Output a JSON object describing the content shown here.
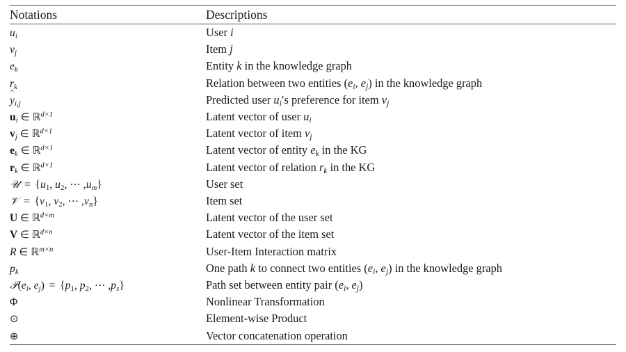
{
  "table": {
    "headers": {
      "notation": "Notations",
      "description": "Descriptions"
    },
    "rows": [
      {
        "notation": "u_i",
        "description": "User i"
      },
      {
        "notation": "v_j",
        "description": "Item j"
      },
      {
        "notation": "e_k",
        "description": "Entity k in the knowledge graph"
      },
      {
        "notation": "r_k",
        "description": "Relation between two entities (e_i, e_j) in the knowledge graph"
      },
      {
        "notation": "ŷ_{i,j}",
        "description": "Predicted user u_i's preference for item v_j"
      },
      {
        "notation": "u_i ∈ ℝ^{d×1}",
        "description": "Latent vector of user u_i"
      },
      {
        "notation": "v_j ∈ ℝ^{d×1}",
        "description": "Latent vector of item v_j"
      },
      {
        "notation": "e_k ∈ ℝ^{d×1}",
        "description": "Latent vector of entity e_k in the KG"
      },
      {
        "notation": "r_k ∈ ℝ^{d×1}",
        "description": "Latent vector of relation r_k in the KG"
      },
      {
        "notation": "𝒰 = {u_1, u_2, ⋯ , u_m}",
        "description": "User set"
      },
      {
        "notation": "𝒱 = {v_1, v_2, ⋯ , v_n}",
        "description": "Item set"
      },
      {
        "notation": "U ∈ ℝ^{d×m}",
        "description": "Latent vector of the user set"
      },
      {
        "notation": "V ∈ ℝ^{d×n}",
        "description": "Latent vector of the item set"
      },
      {
        "notation": "R ∈ ℝ^{m×n}",
        "description": "User-Item Interaction matrix"
      },
      {
        "notation": "p_k",
        "description": "One path k to connect two entities (e_i, e_j) in the knowledge graph"
      },
      {
        "notation": "𝒫(e_i, e_j) = {p_1, p_2, ⋯ , p_s}",
        "description": "Path set between entity pair (e_i, e_j)"
      },
      {
        "notation": "Φ",
        "description": "Nonlinear Transformation"
      },
      {
        "notation": "⊙",
        "description": "Element-wise Product"
      },
      {
        "notation": "⊕",
        "description": "Vector concatenation operation"
      }
    ]
  },
  "symbols": {
    "u": "u",
    "v": "v",
    "e": "e",
    "r": "r",
    "p": "p",
    "R": "R",
    "U_bold": "U",
    "V_bold": "V",
    "i": "i",
    "j": "j",
    "k": "k",
    "m": "m",
    "n": "n",
    "s": "s",
    "d": "d",
    "one": "1",
    "two": "2",
    "y_hat": "y",
    "hat_accent": "ˆ",
    "cal_U": "𝒰",
    "cal_V": "𝒱",
    "cal_P": "𝒫",
    "elem_of": "∈",
    "reals": "ℝ",
    "times": "×",
    "equals": "=",
    "lbrace": "{",
    "rbrace": "}",
    "lparen": "(",
    "rparen": ")",
    "comma": ",",
    "cdots": "⋯",
    "apostrophe": "′",
    "phi": "Φ",
    "odot": "⊙",
    "oplus": "⊕",
    "sub_ij": "i,j",
    "exp_d1": "d×1",
    "exp_dm": "d×m",
    "exp_dn": "d×n",
    "exp_mn": "m×n"
  },
  "text": {
    "user": "User",
    "item": "Item",
    "entity_in_kg": "Entity",
    "in_the_kg_graph": "in the knowledge graph",
    "relation_between": "Relation between two entities",
    "predicted_user": "Predicted user",
    "s_preference_for_item": "s preference for item",
    "latent_vector_of_user": "Latent vector of user",
    "latent_vector_of_item": "Latent vector of item",
    "latent_vector_of_entity": "Latent vector of entity",
    "latent_vector_of_relation": "Latent vector of relation",
    "in_the_kg": "in the KG",
    "user_set": "User set",
    "item_set": "Item set",
    "latent_vector_user_set": "Latent vector of the user set",
    "latent_vector_item_set": "Latent vector of the item set",
    "interaction_matrix": "User-Item Interaction matrix",
    "one_path": "One path",
    "to_connect_two_entities": "to connect two entities",
    "path_set_between": "Path set between entity pair",
    "nonlinear_transformation": "Nonlinear Transformation",
    "elementwise_product": "Element-wise Product",
    "vector_concatenation": "Vector concatenation operation"
  },
  "style": {
    "background": "#ffffff",
    "text_color": "#1a1a1a",
    "rule_color": "#55595c"
  }
}
